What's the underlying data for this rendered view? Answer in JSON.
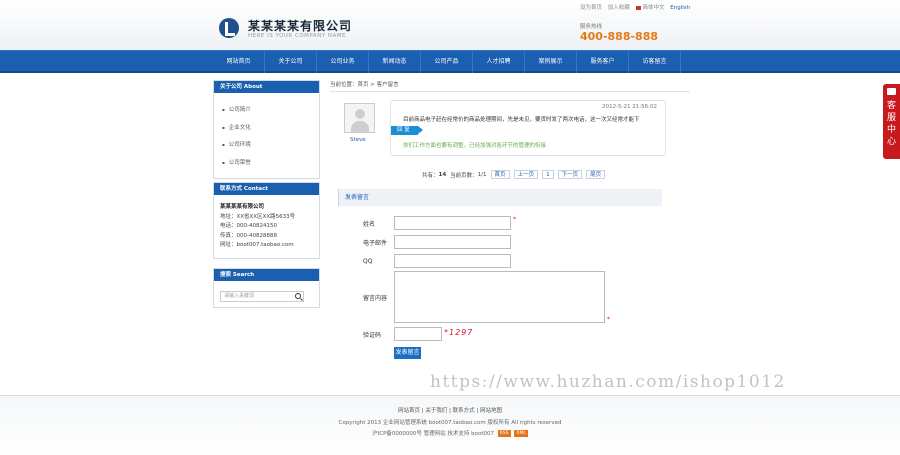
{
  "header": {
    "toplinks": [
      "设为首页",
      "加入收藏"
    ],
    "lang_cn": "简体中文",
    "lang_en": "English",
    "company_name": "某某某某有限公司",
    "company_en": "HERE IS YOUR COMPANY NAME",
    "hotline_label": "服务热线",
    "hotline": "400-888-888"
  },
  "nav": [
    "网站首页",
    "关于公司",
    "公司业务",
    "新闻动态",
    "公司产品",
    "人才招聘",
    "案例展示",
    "服务客户",
    "访客留言"
  ],
  "sidebar": {
    "about_title": "关于公司 About",
    "about_items": [
      "公司简介",
      "企业文化",
      "公司环境",
      "公司荣誉"
    ],
    "contact_title": "联系方式 Contact",
    "contact_company": "某某某某有限公司",
    "contact_lines": [
      "地址：XX省XX区XX路5633号",
      "电话：000-40824150",
      "传真：000-40828888",
      "网址：boot007.taobao.com"
    ],
    "search_title": "搜索 Search",
    "search_placeholder": "请输入关键词"
  },
  "main": {
    "breadcrumb": "当前位置：首页 > 客户留言",
    "message": {
      "user": "Steve",
      "time": "2012-5-21 21:56:02",
      "text": "目前商品电子赶在经常价的商品处理期间，先是未见，要货时发了两次电话，这一次又经常才能下",
      "reply_tag": "回 复",
      "reply_text": "你们工作方面也要有调整，已经加强对各环节的管理的衔接"
    },
    "pager": {
      "total_label": "共有：",
      "total_count": "14",
      "page_label": "当前页数：",
      "page_value": "1/1",
      "first": "首页",
      "prev": "上一页",
      "current": "1",
      "next": "下一页",
      "last": "尾页"
    },
    "form": {
      "title": "发表留言",
      "name_label": "姓名",
      "email_label": "电子邮件",
      "qq_label": "QQ",
      "content_label": "留言内容",
      "code_label": "验证码",
      "required_mark": "*",
      "captcha": "*1297",
      "submit_label": "发表留言"
    }
  },
  "side_tab": {
    "label": "客服中心"
  },
  "footer": {
    "links": "网站首页 | 关于我们 | 联系方式 | 网站地图",
    "copyright": "Copyright 2013 企业网站管理系统 boot007.taobao.com 版权所有 All rights reserved",
    "icp": "沪ICP备0000000号 管理网站 技术支持 boot007",
    "badge_rss": "RSS",
    "badge_xml": "XML"
  },
  "watermark": "https://www.huzhan.com/ishop1012"
}
